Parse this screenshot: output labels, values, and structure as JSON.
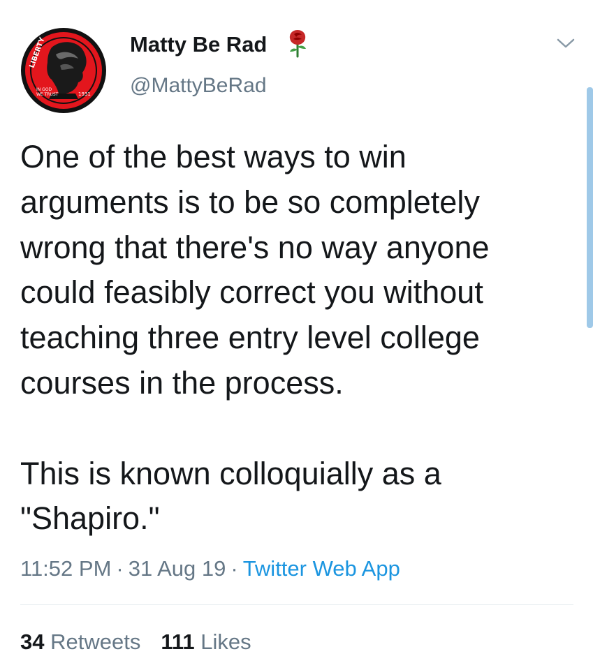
{
  "user": {
    "display_name": "Matty Be Rad",
    "handle": "@MattyBeRad",
    "avatar_icon": "liberty-dime-avatar",
    "name_emoji": "rose-icon"
  },
  "tweet": {
    "lines": [
      "One of the best ways to win",
      "arguments is to be so completely",
      "wrong that there's no way anyone",
      "could feasibly correct you without",
      "teaching three entry level college",
      "courses in the process.",
      "This is known colloquially as a",
      "\"Shapiro.\""
    ]
  },
  "meta": {
    "time": "11:52 PM",
    "separator": "·",
    "date": "31 Aug 19",
    "source": "Twitter Web App"
  },
  "stats": {
    "retweets_count": "34",
    "retweets_label": "Retweets",
    "likes_count": "111",
    "likes_label": "Likes"
  },
  "colors": {
    "text": "#14171a",
    "secondary": "#657786",
    "link": "#1b95e0",
    "divider": "#e6ecf0",
    "scrollbar": "#9fc9e8"
  }
}
